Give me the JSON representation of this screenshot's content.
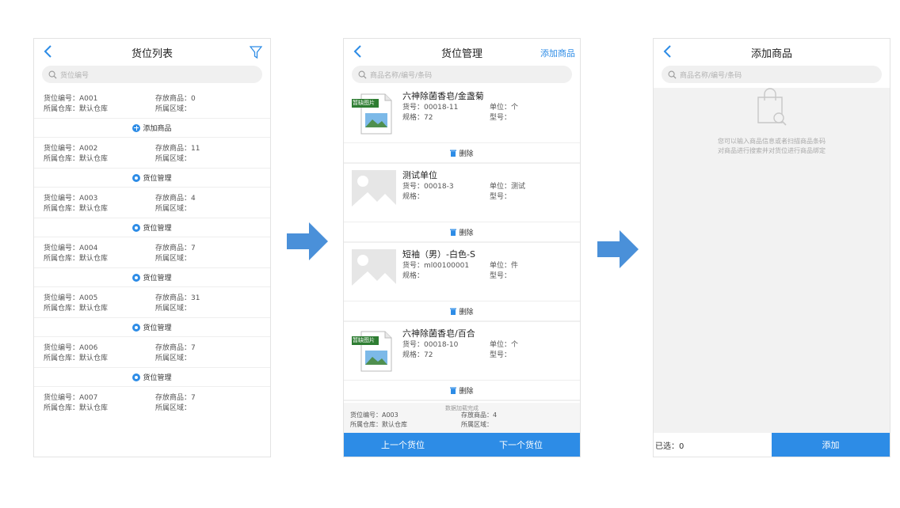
{
  "page1": {
    "title": "货位列表",
    "search_placeholder": "货位编号",
    "slots": [
      {
        "code": "货位编号：A001",
        "count": "存放商品：0",
        "warehouse": "所属仓库：默认仓库",
        "area": "所属区域：",
        "action": "添加商品",
        "action_icon": "plus-circle-icon"
      },
      {
        "code": "货位编号：A002",
        "count": "存放商品：11",
        "warehouse": "所属仓库：默认仓库",
        "area": "所属区域：",
        "action": "货位管理",
        "action_icon": "gear-icon"
      },
      {
        "code": "货位编号：A003",
        "count": "存放商品：4",
        "warehouse": "所属仓库：默认仓库",
        "area": "所属区域：",
        "action": "货位管理",
        "action_icon": "gear-icon"
      },
      {
        "code": "货位编号：A004",
        "count": "存放商品：7",
        "warehouse": "所属仓库：默认仓库",
        "area": "所属区域：",
        "action": "货位管理",
        "action_icon": "gear-icon"
      },
      {
        "code": "货位编号：A005",
        "count": "存放商品：31",
        "warehouse": "所属仓库：默认仓库",
        "area": "所属区域：",
        "action": "货位管理",
        "action_icon": "gear-icon"
      },
      {
        "code": "货位编号：A006",
        "count": "存放商品：7",
        "warehouse": "所属仓库：默认仓库",
        "area": "所属区域：",
        "action": "货位管理",
        "action_icon": "gear-icon"
      },
      {
        "code": "货位编号：A007",
        "count": "存放商品：7",
        "warehouse": "所属仓库：默认仓库",
        "area": "所属区域：",
        "action": "",
        "action_icon": ""
      }
    ]
  },
  "page2": {
    "title": "货位管理",
    "add_label": "添加商品",
    "search_placeholder": "商品名称/编号/条码",
    "goods": [
      {
        "name": "六神除菌香皂/金盏菊",
        "code": "货号：00018-11",
        "unit": "单位：个",
        "spec": "规格：72",
        "model": "型号：",
        "image": "no-image-tag",
        "image_tag": "暂缺图片",
        "delete": "删除"
      },
      {
        "name": "测试单位",
        "code": "货号：00018-3",
        "unit": "单位：测试",
        "spec": "规格：",
        "model": "型号：",
        "image": "placeholder-image",
        "image_tag": "",
        "delete": "删除"
      },
      {
        "name": "短袖（男）-白色-S",
        "code": "货号：ml00100001",
        "unit": "单位：件",
        "spec": "规格：",
        "model": "型号：",
        "image": "placeholder-image",
        "image_tag": "",
        "delete": "删除"
      },
      {
        "name": "六神除菌香皂/百合",
        "code": "货号：00018-10",
        "unit": "单位：个",
        "spec": "规格：72",
        "model": "型号：",
        "image": "no-image-tag",
        "image_tag": "暂缺图片",
        "delete": "删除"
      }
    ],
    "loading_text": "数据加载完成",
    "info": {
      "code": "货位编号：A003",
      "count": "存放商品：4",
      "warehouse": "所属仓库：默认仓库",
      "area": "所属区域："
    },
    "prev_label": "上一个货位",
    "next_label": "下一个货位"
  },
  "page3": {
    "title": "添加商品",
    "search_placeholder": "商品名称/编号/条码",
    "empty_tip_1": "您可以输入商品信息或者扫描商品条码",
    "empty_tip_2": "对商品进行搜索并对货位进行商品绑定",
    "selected_label": "已选：0",
    "add_label": "添加"
  },
  "colors": {
    "accent": "#2d8ce6",
    "arrow": "#4a90d9"
  }
}
